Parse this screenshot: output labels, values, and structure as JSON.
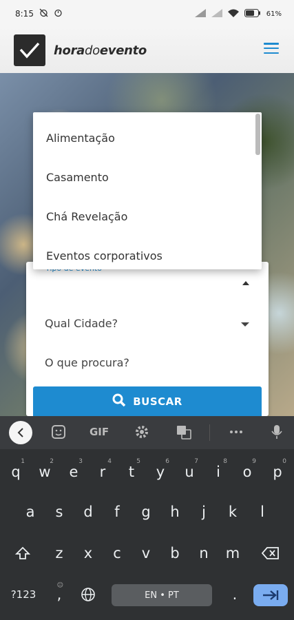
{
  "status": {
    "time": "8:15",
    "battery": "61"
  },
  "header": {
    "brand_bold_a": "hora",
    "brand_mid": "do",
    "brand_bold_b": "evento"
  },
  "dropdown": {
    "items": [
      "Alimentação",
      "Casamento",
      "Chá Revelação",
      "Eventos corporativos"
    ]
  },
  "form": {
    "tipo_label": "Tipo de evento",
    "cidade_placeholder": "Qual Cidade?",
    "procura_placeholder": "O que procura?",
    "buscar_label": "BUSCAR"
  },
  "keyboard": {
    "gif_label": "GIF",
    "row1": [
      "q",
      "w",
      "e",
      "r",
      "t",
      "y",
      "u",
      "i",
      "o",
      "p"
    ],
    "row1_sup": [
      "1",
      "2",
      "3",
      "4",
      "5",
      "6",
      "7",
      "8",
      "9",
      "0"
    ],
    "row2": [
      "a",
      "s",
      "d",
      "f",
      "g",
      "h",
      "j",
      "k",
      "l"
    ],
    "row3": [
      "z",
      "x",
      "c",
      "v",
      "b",
      "n",
      "m"
    ],
    "symbols_label": "?123",
    "comma": ",",
    "space_label": "EN • PT",
    "period": "."
  },
  "colors": {
    "accent": "#1e8bd0",
    "keyboard_bg": "#2f3133",
    "enter_key": "#7aacf0"
  },
  "icons": [
    "alarm-off-icon",
    "alarm-icon",
    "signal-icon",
    "wifi-icon",
    "battery-icon",
    "menu-icon",
    "search-icon",
    "back-icon",
    "sticker-icon",
    "settings-icon",
    "translate-icon",
    "more-icon",
    "mic-icon",
    "shift-icon",
    "backspace-icon",
    "globe-icon",
    "enter-icon",
    "emoji-icon"
  ]
}
